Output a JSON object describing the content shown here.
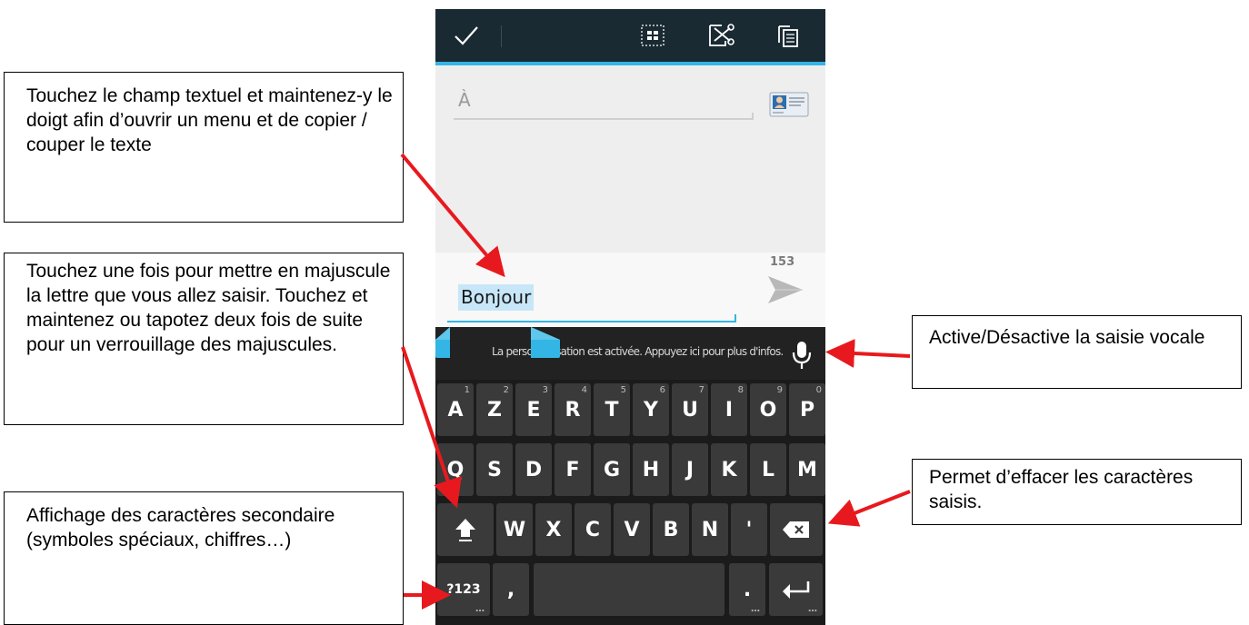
{
  "annotations": {
    "copy_cut": "Touchez le champ textuel et maintenez-y le doigt afin d’ouvrir un menu et de copier / couper le texte",
    "shift": "Touchez une fois pour mettre en majuscule la lettre que vous allez saisir. Touchez et maintenez ou tapotez deux fois de suite pour un verrouillage des majuscules.",
    "symbols": "Affichage des caractères secondaire (symboles spéciaux, chiffres…)",
    "voice": "Active/Désactive la saisie vocale",
    "delete": "Permet d’effacer les caractères saisis."
  },
  "action_bar": {
    "icons": [
      "check-icon",
      "select-all-icon",
      "cut-icon",
      "copy-icon"
    ],
    "background": "#1a2a33",
    "accent": "#33b5e5"
  },
  "compose": {
    "to_placeholder": "À",
    "char_count": "153",
    "message": "Bonjour"
  },
  "keyboard": {
    "suggestion": "La personnalisation est activée. Appuyez ici pour plus d'infos.",
    "row1": [
      {
        "label": "A",
        "alt": "1"
      },
      {
        "label": "Z",
        "alt": "2"
      },
      {
        "label": "E",
        "alt": "3"
      },
      {
        "label": "R",
        "alt": "4"
      },
      {
        "label": "T",
        "alt": "5"
      },
      {
        "label": "Y",
        "alt": "6"
      },
      {
        "label": "U",
        "alt": "7"
      },
      {
        "label": "I",
        "alt": "8"
      },
      {
        "label": "O",
        "alt": "9"
      },
      {
        "label": "P",
        "alt": "0"
      }
    ],
    "row2": [
      "Q",
      "S",
      "D",
      "F",
      "G",
      "H",
      "J",
      "K",
      "L",
      "M"
    ],
    "row3": [
      "W",
      "X",
      "C",
      "V",
      "B",
      "N",
      "'"
    ],
    "symbols_label": "?123",
    "comma_label": ",",
    "period_label": ".",
    "ellipsis": "…"
  },
  "arrow_color": "#e8191e"
}
